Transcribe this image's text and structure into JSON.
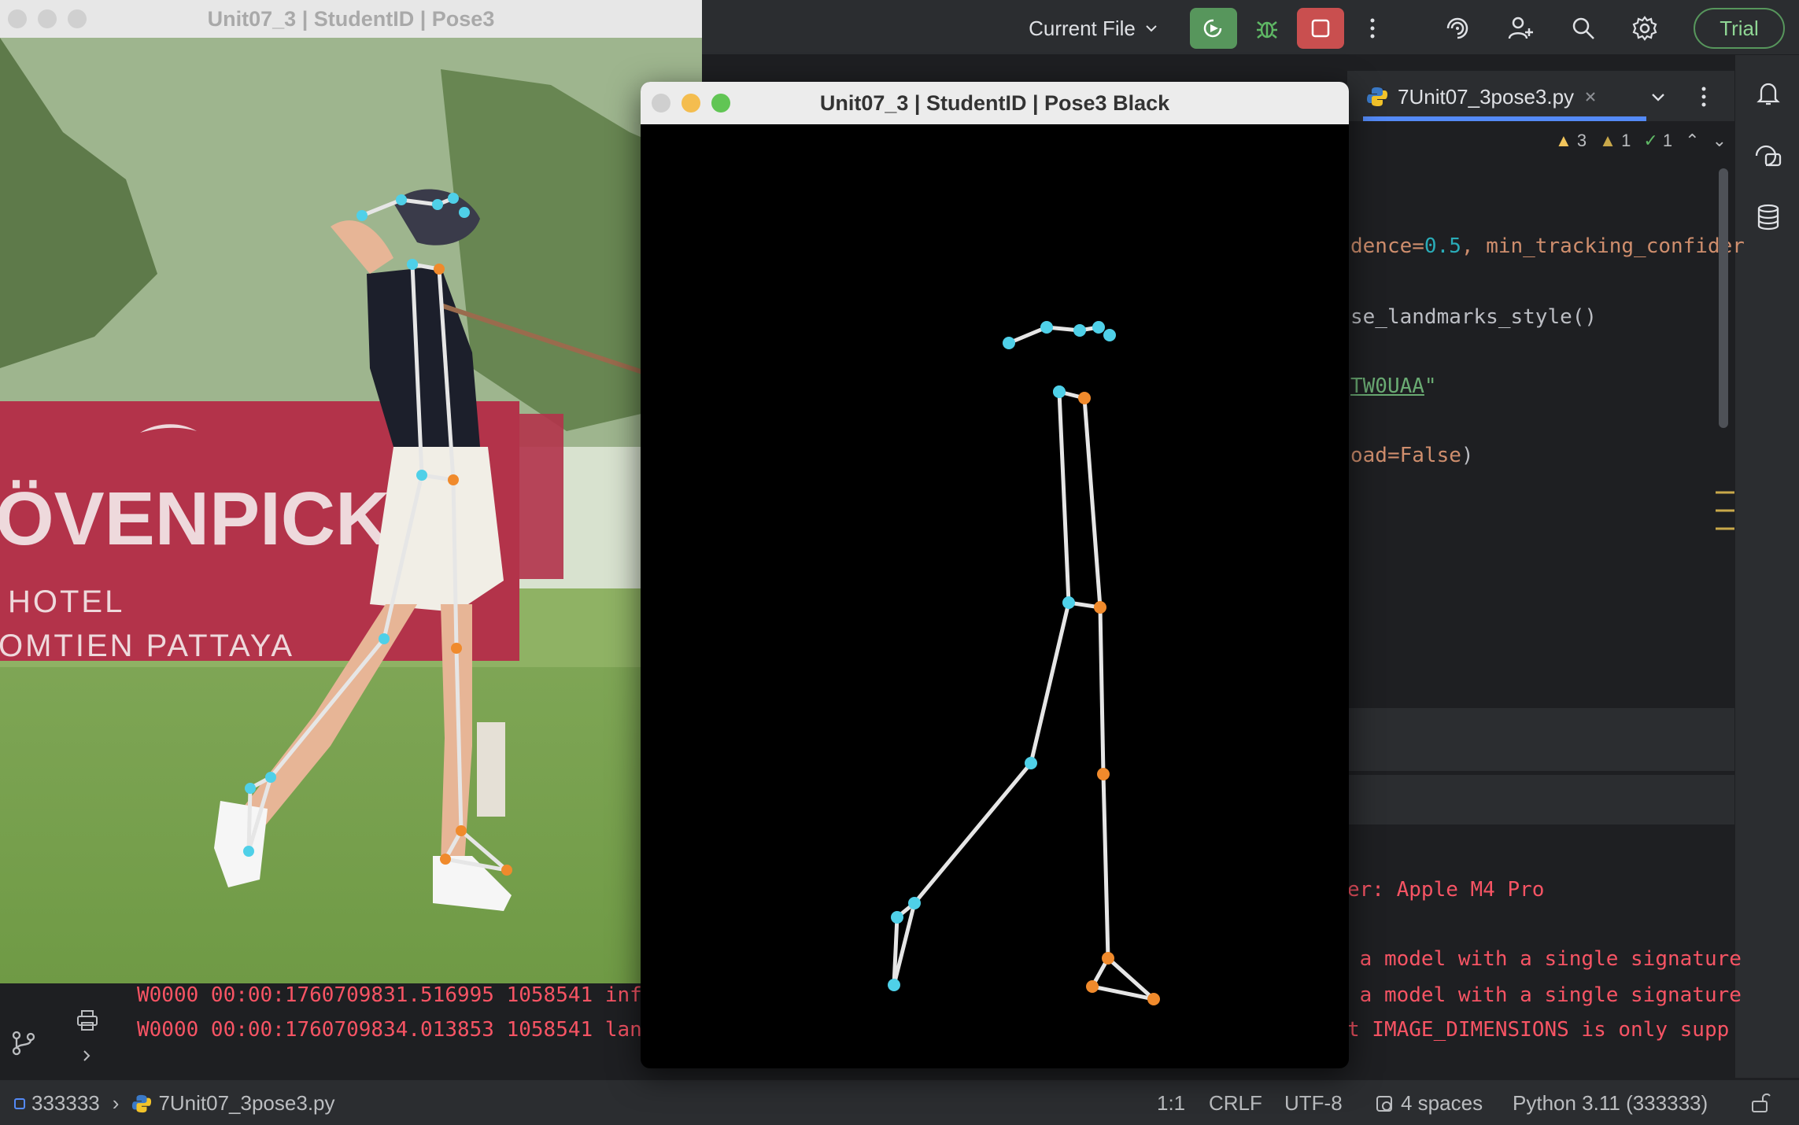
{
  "topbar": {
    "run_config_label": "Current File",
    "trial_label": "Trial",
    "icons": [
      "run-icon",
      "debug-icon",
      "stop-icon",
      "more-icon",
      "ai-assistant-icon",
      "add-user-icon",
      "search-icon",
      "settings-icon"
    ]
  },
  "editor": {
    "tab_label": "7Unit07_3pose3.py",
    "inspections": {
      "warnings": "3",
      "weak_warnings": "1",
      "ok": "1"
    },
    "code": {
      "l1_a": "dence=",
      "l1_b": "0.5",
      "l1_c": ", min_tracking_confider",
      "l2": "se_landmarks_style()",
      "l3_a": "TW0UAA",
      "l3_b": "\"",
      "l4_a": "oad=",
      "l4_b": "False",
      "l4_c": ")"
    }
  },
  "console": {
    "left_lines": [
      "W0000 00:00:1760709831.516995 1058541 inf",
      "W0000 00:00:1760709834.013853 1058541 lan"
    ],
    "right_lines": [
      "er: Apple M4 Pro",
      " a model with a single signature",
      " a model with a single signature",
      "t IMAGE_DIMENSIONS is only supp"
    ]
  },
  "statusbar": {
    "project": "333333",
    "file": "7Unit07_3pose3.py",
    "position": "1:1",
    "line_sep": "CRLF",
    "encoding": "UTF-8",
    "indent": "4 spaces",
    "interpreter": "Python 3.11 (333333)"
  },
  "windows": {
    "pose3": {
      "title": "Unit07_3 | StudentID | Pose3"
    },
    "black": {
      "title": "Unit07_3 | StudentID | Pose3 Black"
    }
  },
  "photo": {
    "sign_line1": "ÖVENPICK",
    "sign_line2": "HOTEL",
    "sign_line3": "OMTIEN PATTAYA"
  },
  "colors": {
    "left_landmark": "#4fd0e8",
    "right_landmark": "#f08a2c",
    "connection": "#e6e6e6",
    "sign_bg": "#b3334a"
  }
}
